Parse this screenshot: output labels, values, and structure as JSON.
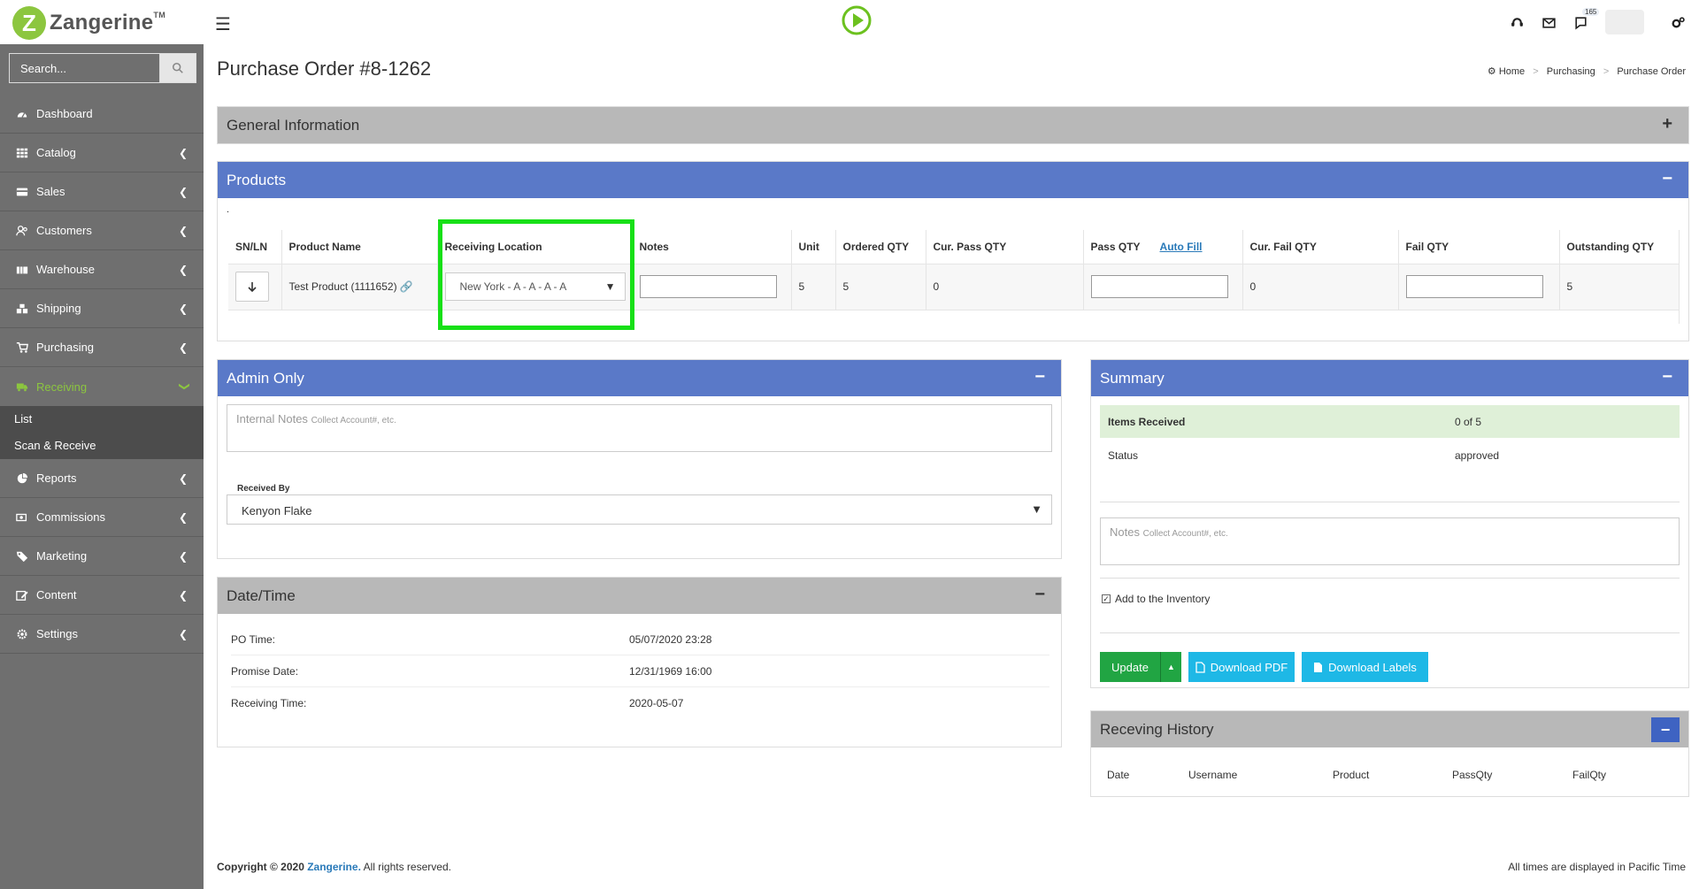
{
  "app": {
    "brand": "Zangerine",
    "trademark": "TM"
  },
  "topbar": {
    "notification_count": "165"
  },
  "search": {
    "placeholder": "Search..."
  },
  "nav": [
    {
      "label": "Dashboard",
      "icon": "dashboard-icon"
    },
    {
      "label": "Catalog",
      "icon": "grid-icon"
    },
    {
      "label": "Sales",
      "icon": "credit-card-icon"
    },
    {
      "label": "Customers",
      "icon": "users-icon"
    },
    {
      "label": "Warehouse",
      "icon": "warehouse-icon"
    },
    {
      "label": "Shipping",
      "icon": "boxes-icon"
    },
    {
      "label": "Purchasing",
      "icon": "cart-icon"
    },
    {
      "label": "Receiving",
      "icon": "truck-icon"
    },
    {
      "label": "Reports",
      "icon": "pie-chart-icon"
    },
    {
      "label": "Commissions",
      "icon": "money-icon"
    },
    {
      "label": "Marketing",
      "icon": "tag-icon"
    },
    {
      "label": "Content",
      "icon": "edit-icon"
    },
    {
      "label": "Settings",
      "icon": "gear-icon"
    }
  ],
  "nav_sub": [
    "List",
    "Scan & Receive"
  ],
  "page": {
    "title": "Purchase Order #8-1262",
    "breadcrumb": [
      "Home",
      "Purchasing",
      "Purchase Order"
    ]
  },
  "general": {
    "title": "General Information",
    "toggle": "+"
  },
  "products": {
    "title": "Products",
    "toggle": "−",
    "dot": ".",
    "columns": [
      "SN/LN",
      "Product Name",
      "Receiving Location",
      "Notes",
      "Unit",
      "Ordered QTY",
      "Cur. Pass QTY",
      "Pass QTY",
      "Auto Fill",
      "Cur. Fail QTY",
      "Fail QTY",
      "Outstanding QTY"
    ],
    "row": {
      "product_name": "Test Product (1111652)",
      "location": "New York - A - A - A - A",
      "unit": "5",
      "ordered": "5",
      "cur_pass": "0",
      "cur_fail": "0",
      "outstanding": "5"
    }
  },
  "admin": {
    "title": "Admin Only",
    "toggle": "−",
    "internal_notes_label": "Internal Notes",
    "internal_notes_hint": "Collect Account#, etc.",
    "received_by_label": "Received By",
    "received_by_value": "Kenyon Flake"
  },
  "datetime": {
    "title": "Date/Time",
    "toggle": "−",
    "rows": [
      {
        "k": "PO Time:",
        "v": "05/07/2020 23:28"
      },
      {
        "k": "Promise Date:",
        "v": "12/31/1969 16:00"
      },
      {
        "k": "Receiving Time:",
        "v": "2020-05-07"
      }
    ]
  },
  "summary": {
    "title": "Summary",
    "toggle": "−",
    "items_received_label": "Items Received",
    "items_received_value": "0 of 5",
    "status_label": "Status",
    "status_value": "approved",
    "notes_label": "Notes",
    "notes_hint": "Collect Account#, etc.",
    "add_inventory": "Add to the Inventory",
    "buttons": {
      "update": "Update",
      "download_pdf": "Download PDF",
      "download_labels": "Download Labels"
    }
  },
  "history": {
    "title": "Receving History",
    "toggle": "−",
    "columns": [
      "Date",
      "Username",
      "Product",
      "PassQty",
      "FailQty"
    ]
  },
  "footer": {
    "copyright_prefix": "Copyright © 2020",
    "brand": "Zangerine.",
    "suffix": "All rights reserved.",
    "timezone": "All times are displayed in Pacific Time"
  }
}
